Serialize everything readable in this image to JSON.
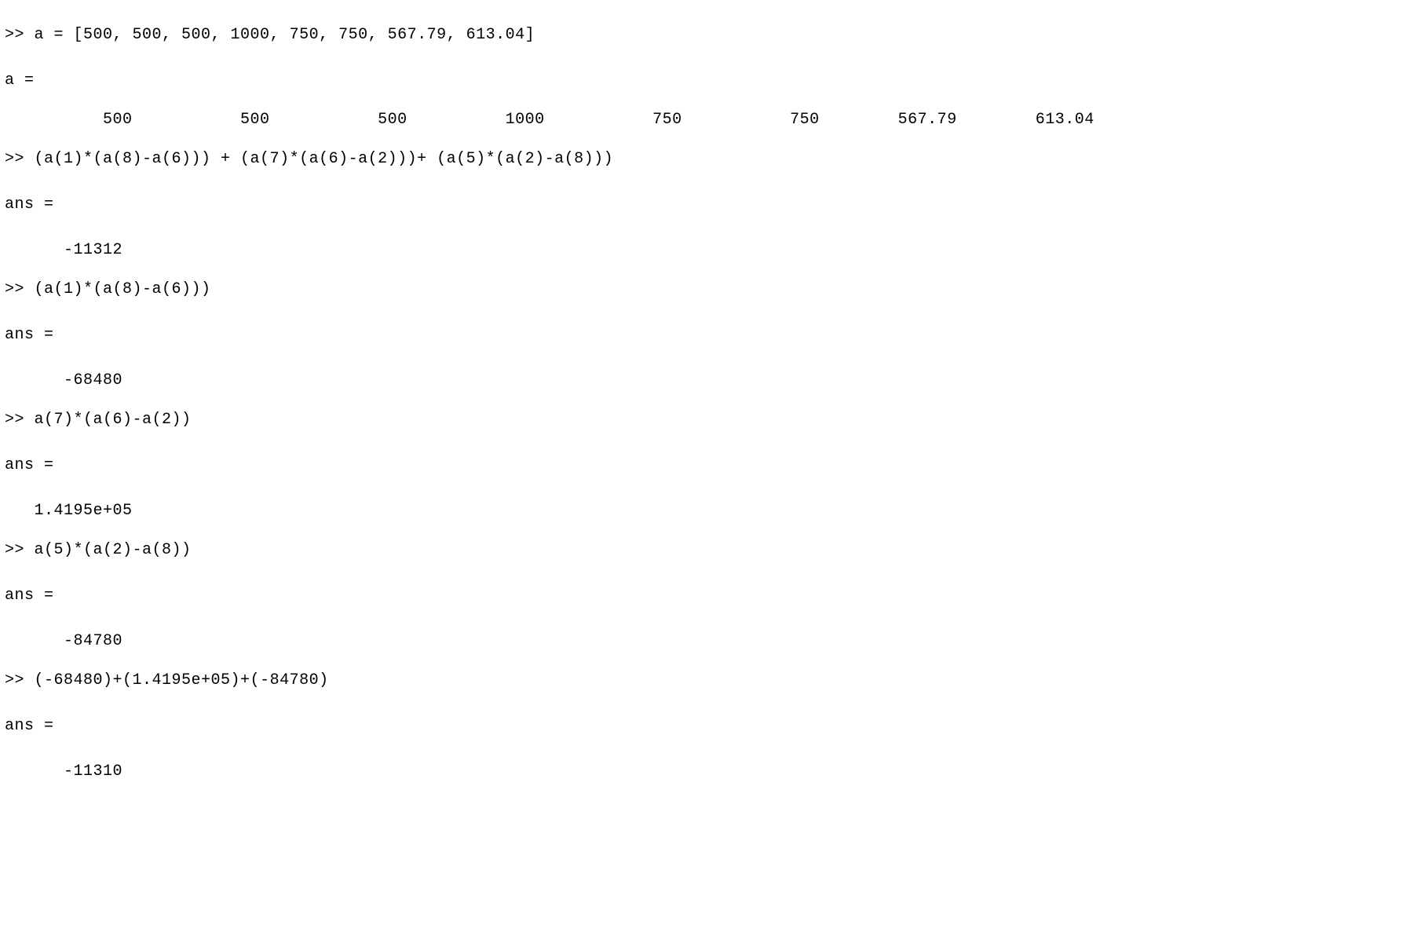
{
  "prompt": ">> ",
  "lines": {
    "cmd1": "a = [500, 500, 500, 1000, 750, 750, 567.79, 613.04]",
    "aHeader": "a =",
    "aRow": "          500           500           500          1000           750           750        567.79        613.04",
    "cmd2": "(a(1)*(a(8)-a(6))) + (a(7)*(a(6)-a(2)))+ (a(5)*(a(2)-a(8)))",
    "ansHeader": "ans =",
    "ans2": "      -11312",
    "cmd3": "(a(1)*(a(8)-a(6)))",
    "ans3": "      -68480",
    "cmd4": "a(7)*(a(6)-a(2))",
    "ans4": "   1.4195e+05",
    "cmd5": "a(5)*(a(2)-a(8))",
    "ans5": "      -84780",
    "cmd6": "(-68480)+(1.4195e+05)+(-84780)",
    "ans6": "      -11310"
  }
}
